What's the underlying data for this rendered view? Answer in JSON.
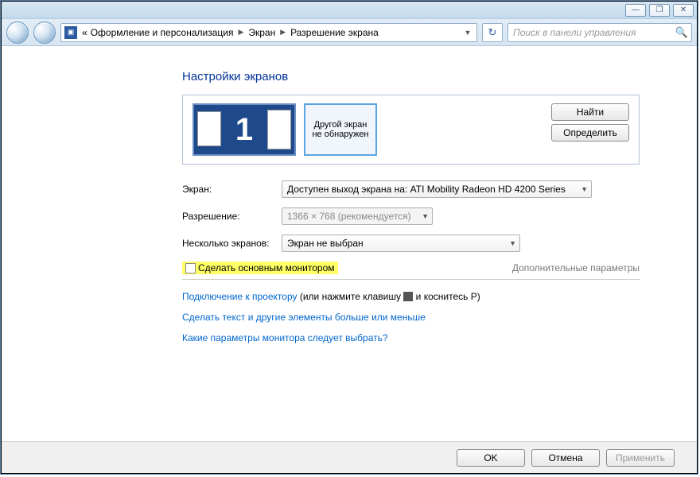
{
  "window_controls": {
    "minimize": "—",
    "maximize": "❐",
    "close": "✕"
  },
  "breadcrumb": {
    "prefix": "«",
    "seg1": "Оформление и персонализация",
    "seg2": "Экран",
    "seg3": "Разрешение экрана"
  },
  "refresh_icon": "↻",
  "search": {
    "placeholder": "Поиск в панели управления"
  },
  "page_title": "Настройки экранов",
  "monitor_number": "1",
  "no_detect_text": "Другой экран не обнаружен",
  "side_buttons": {
    "find": "Найти",
    "identify": "Определить"
  },
  "options": {
    "screen_label": "Экран:",
    "screen_value": "Доступен выход экрана на: ATI Mobility Radeon HD 4200 Series",
    "resolution_label": "Разрешение:",
    "resolution_value": "1366 × 768 (рекомендуется)",
    "multi_label": "Несколько экранов:",
    "multi_value": "Экран не выбран"
  },
  "make_primary": "Сделать основным монитором",
  "additional_params": "Дополнительные параметры",
  "projector_text_pre": "Подключение к проектору",
  "projector_text_post": " (или нажмите клавишу ",
  "projector_text_post2": " и коснитесь P)",
  "link_text_size": "Сделать текст и другие элементы больше или меньше",
  "link_which_params": "Какие параметры монитора следует выбрать?",
  "footer": {
    "ok": "OK",
    "cancel": "Отмена",
    "apply": "Применить"
  }
}
